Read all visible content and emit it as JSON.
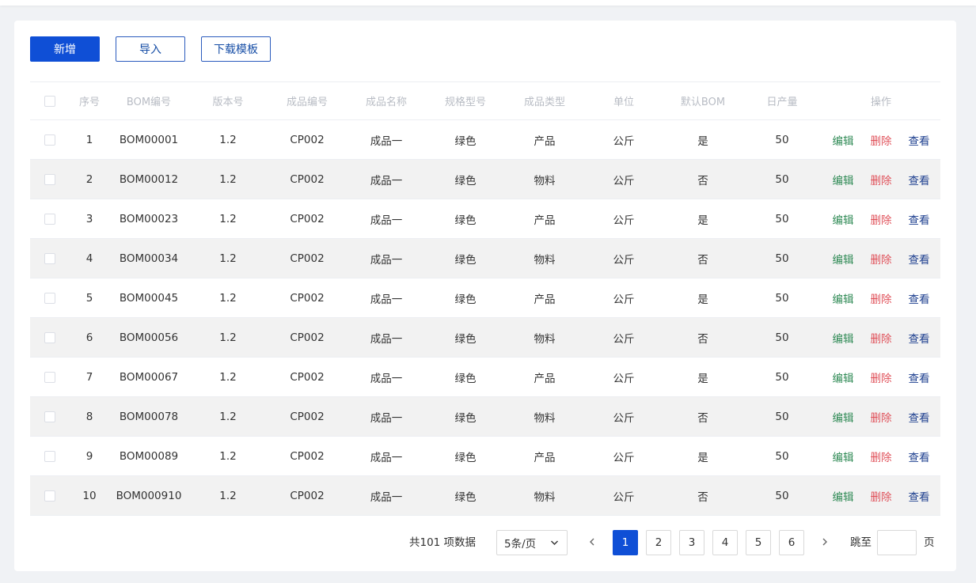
{
  "toolbar": {
    "add_label": "新增",
    "import_label": "导入",
    "download_label": "下载模板"
  },
  "table": {
    "columns": [
      "序号",
      "BOM编号",
      "版本号",
      "成品编号",
      "成品名称",
      "规格型号",
      "成品类型",
      "单位",
      "默认BOM",
      "日产量",
      "操作"
    ],
    "actions": {
      "edit": "编辑",
      "delete": "删除",
      "view": "查看"
    },
    "rows": [
      {
        "no": "1",
        "bom": "BOM00001",
        "version": "1.2",
        "product_code": "CP002",
        "product_name": "成品一",
        "spec": "绿色",
        "type": "产品",
        "unit": "公斤",
        "default_bom": "是",
        "daily_output": "50"
      },
      {
        "no": "2",
        "bom": "BOM00012",
        "version": "1.2",
        "product_code": "CP002",
        "product_name": "成品一",
        "spec": "绿色",
        "type": "物料",
        "unit": "公斤",
        "default_bom": "否",
        "daily_output": "50"
      },
      {
        "no": "3",
        "bom": "BOM00023",
        "version": "1.2",
        "product_code": "CP002",
        "product_name": "成品一",
        "spec": "绿色",
        "type": "产品",
        "unit": "公斤",
        "default_bom": "是",
        "daily_output": "50"
      },
      {
        "no": "4",
        "bom": "BOM00034",
        "version": "1.2",
        "product_code": "CP002",
        "product_name": "成品一",
        "spec": "绿色",
        "type": "物料",
        "unit": "公斤",
        "default_bom": "否",
        "daily_output": "50"
      },
      {
        "no": "5",
        "bom": "BOM00045",
        "version": "1.2",
        "product_code": "CP002",
        "product_name": "成品一",
        "spec": "绿色",
        "type": "产品",
        "unit": "公斤",
        "default_bom": "是",
        "daily_output": "50"
      },
      {
        "no": "6",
        "bom": "BOM00056",
        "version": "1.2",
        "product_code": "CP002",
        "product_name": "成品一",
        "spec": "绿色",
        "type": "物料",
        "unit": "公斤",
        "default_bom": "否",
        "daily_output": "50"
      },
      {
        "no": "7",
        "bom": "BOM00067",
        "version": "1.2",
        "product_code": "CP002",
        "product_name": "成品一",
        "spec": "绿色",
        "type": "产品",
        "unit": "公斤",
        "default_bom": "是",
        "daily_output": "50"
      },
      {
        "no": "8",
        "bom": "BOM00078",
        "version": "1.2",
        "product_code": "CP002",
        "product_name": "成品一",
        "spec": "绿色",
        "type": "物料",
        "unit": "公斤",
        "default_bom": "否",
        "daily_output": "50"
      },
      {
        "no": "9",
        "bom": "BOM00089",
        "version": "1.2",
        "product_code": "CP002",
        "product_name": "成品一",
        "spec": "绿色",
        "type": "产品",
        "unit": "公斤",
        "default_bom": "是",
        "daily_output": "50"
      },
      {
        "no": "10",
        "bom": "BOM000910",
        "version": "1.2",
        "product_code": "CP002",
        "product_name": "成品一",
        "spec": "绿色",
        "type": "物料",
        "unit": "公斤",
        "default_bom": "否",
        "daily_output": "50"
      }
    ]
  },
  "pagination": {
    "total_text": "共101 项数据",
    "page_size": "5条/页",
    "prev_icon": "chevron-left-icon",
    "next_icon": "chevron-right-icon",
    "pages": [
      "1",
      "2",
      "3",
      "4",
      "5",
      "6"
    ],
    "current_page": "1",
    "jump_label": "跳至",
    "jump_value": "",
    "jump_suffix": "页"
  },
  "colors": {
    "primary": "#0f4fd6",
    "edit": "#2f8a55",
    "delete": "#e0515a",
    "view": "#1d3f8f"
  }
}
